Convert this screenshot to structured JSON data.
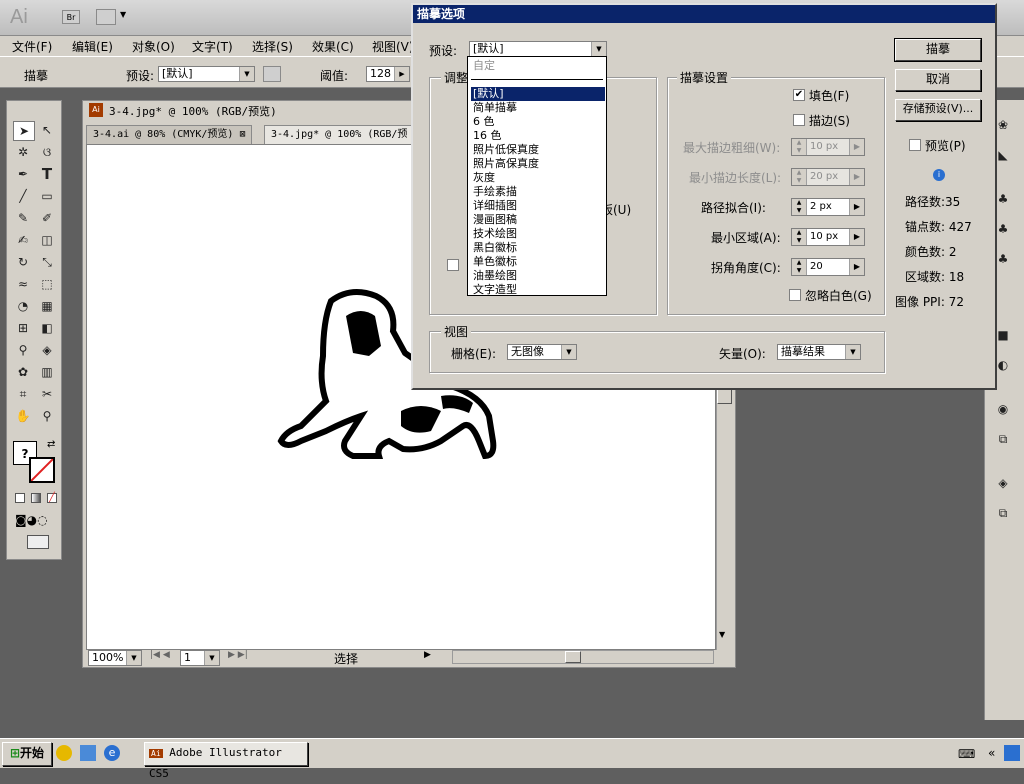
{
  "menubar": [
    "文件(F)",
    "编辑(E)",
    "对象(O)",
    "文字(T)",
    "选择(S)",
    "效果(C)",
    "视图(V)"
  ],
  "ctrlbar": {
    "tool_label": "描摹",
    "preset_label": "预设:",
    "preset_value": "[默认]",
    "threshold_label": "阈值:",
    "threshold_value": "128"
  },
  "doc": {
    "title": "3-4.jpg* @ 100% (RGB/预览)",
    "tabs": [
      "3-4.ai @ 80% (CMYK/预览)",
      "3-4.jpg* @ 100% (RGB/预"
    ],
    "zoom": "100%",
    "page": "1",
    "status": "选择"
  },
  "dialog": {
    "title": "描摹选项",
    "preset_label": "预设:",
    "preset_value": "[默认]",
    "adjust_group": "调整",
    "partial_board_label": "板(U)",
    "trace_group": "描摹设置",
    "fill_label": "填色(F)",
    "fill_checked": true,
    "stroke_label": "描边(S)",
    "stroke_checked": false,
    "max_stroke_label": "最大描边粗细(W):",
    "max_stroke_value": "10 px",
    "min_stroke_label": "最小描边长度(L):",
    "min_stroke_value": "20 px",
    "path_fit_label": "路径拟合(I):",
    "path_fit_value": "2 px",
    "min_area_label": "最小区域(A):",
    "min_area_value": "10 px",
    "corner_label": "拐角角度(C):",
    "corner_value": "20",
    "ignore_white_label": "忽略白色(G)",
    "view_group": "视图",
    "raster_label": "栅格(E):",
    "raster_value": "无图像",
    "vector_label": "矢量(O):",
    "vector_value": "描摹结果",
    "trace_btn": "描摹",
    "cancel_btn": "取消",
    "save_preset_btn": "存储预设(V)...",
    "preview_label": "预览(P)",
    "stats": {
      "paths": "路径数:35",
      "anchors": "锚点数: 427",
      "colors": "颜色数: 2",
      "regions": "区域数: 18",
      "ppi": "图像 PPI: 72"
    }
  },
  "dropdown": {
    "options": [
      "自定",
      "[默认]",
      "简单描摹",
      "6 色",
      "16 色",
      "照片低保真度",
      "照片高保真度",
      "灰度",
      "手绘素描",
      "详细插图",
      "漫画图稿",
      "技术绘图",
      "黑白徽标",
      "单色徽标",
      "油墨绘图",
      "文字造型"
    ],
    "selected": "[默认]"
  },
  "taskbar": {
    "start": "开始",
    "app": "Adobe Illustrator CS5"
  },
  "colors": {
    "title_bar": "#0a246a",
    "selection": "#0a246a",
    "face": "#d4d0c8"
  }
}
